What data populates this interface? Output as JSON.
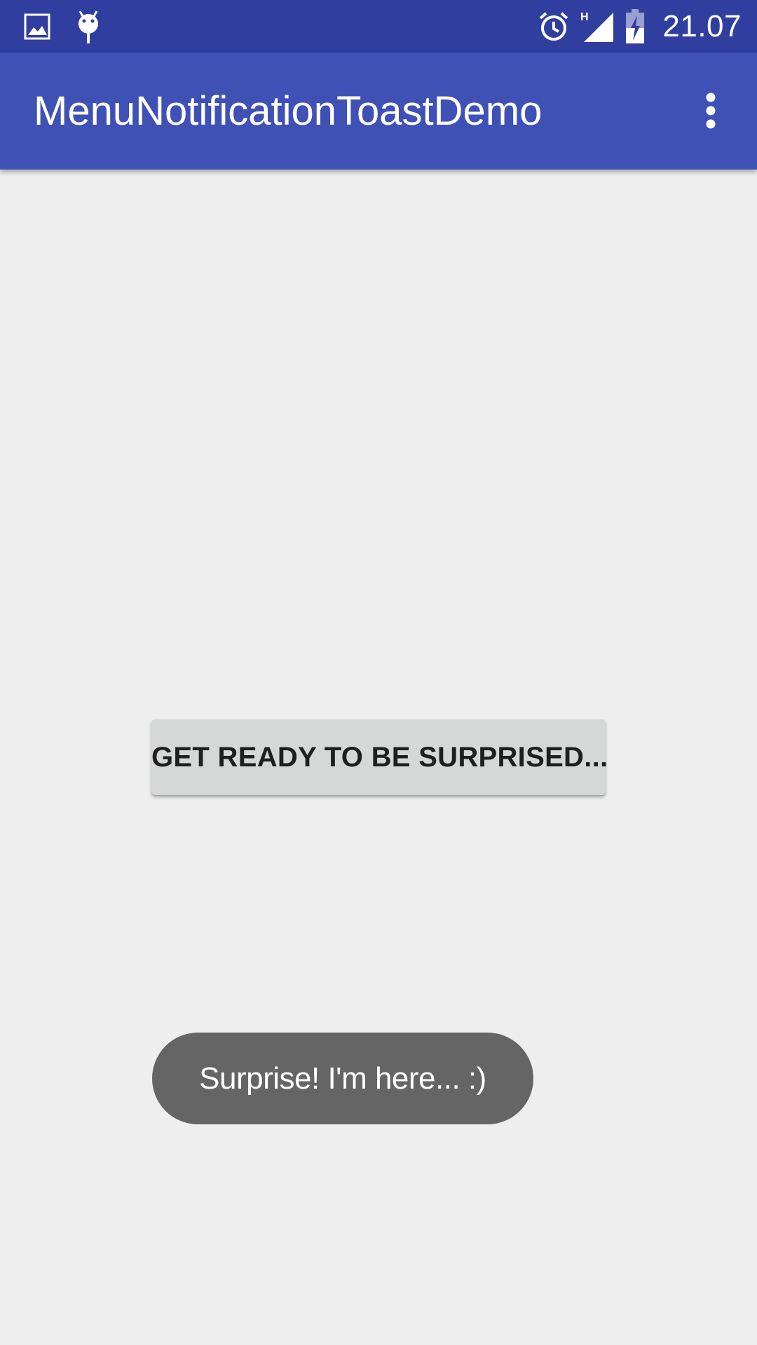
{
  "status_bar": {
    "icons_left": [
      "image-icon",
      "android-icon"
    ],
    "icons_right": [
      "alarm-icon",
      "signal-h-icon",
      "battery-charging-icon"
    ],
    "network_type": "H",
    "time": "21.07",
    "background_color": "#303f9f"
  },
  "app_bar": {
    "title": "MenuNotificationToastDemo",
    "overflow_icon": "more-vert-icon",
    "background_color": "#3f51b5"
  },
  "main": {
    "button_label": "GET READY TO BE SURPRISED..."
  },
  "toast": {
    "message": "Surprise! I'm here... :)"
  },
  "colors": {
    "background": "#eeeeee",
    "button": "#d6d7d7",
    "toast": "#656565"
  }
}
